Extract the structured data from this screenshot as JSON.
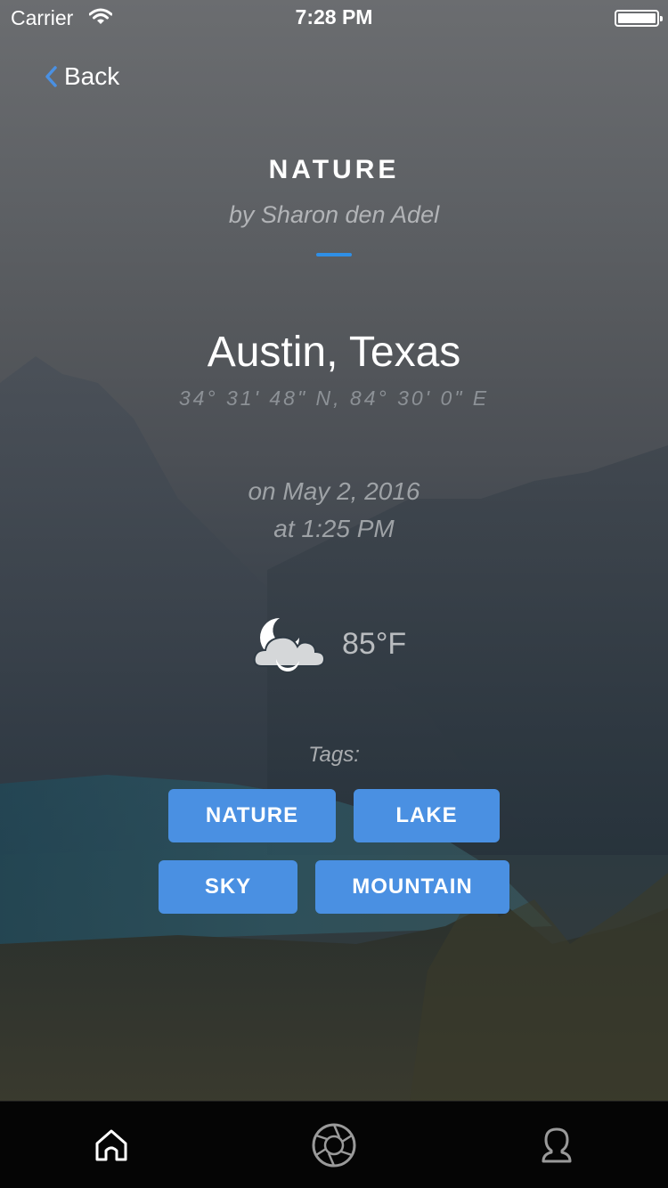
{
  "status_bar": {
    "carrier": "Carrier",
    "time": "7:28 PM"
  },
  "nav": {
    "back_label": "Back",
    "accent_color": "#4a90e2"
  },
  "photo": {
    "title": "NATURE",
    "byline": "by Sharon den Adel",
    "location": "Austin, Texas",
    "coordinates": "34° 31' 48\" N, 84° 30' 0\" E",
    "date": "on May 2, 2016",
    "time": "at 1:25 PM"
  },
  "weather": {
    "icon": "partly-cloudy-night-icon",
    "temperature": "85°F"
  },
  "tags": {
    "label": "Tags:",
    "items": [
      "NATURE",
      "LAKE",
      "SKY",
      "MOUNTAIN"
    ],
    "color": "#4a90e2"
  },
  "tab_bar": {
    "items": [
      {
        "icon": "home-icon",
        "selected": true
      },
      {
        "icon": "camera-aperture-icon",
        "selected": false
      },
      {
        "icon": "profile-icon",
        "selected": false
      }
    ]
  }
}
